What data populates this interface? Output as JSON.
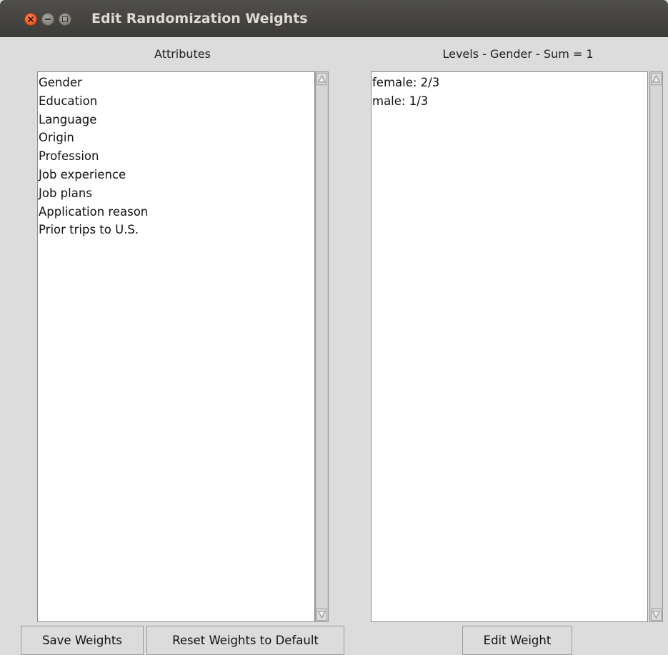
{
  "window": {
    "title": "Edit Randomization Weights",
    "controls": [
      "close-icon",
      "minimize-icon",
      "maximize-icon"
    ]
  },
  "attributes_panel": {
    "label": "Attributes",
    "items": [
      "Gender",
      "Education",
      "Language",
      "Origin",
      "Profession",
      "Job experience",
      "Job plans",
      "Application reason",
      "Prior trips to U.S."
    ]
  },
  "levels_panel": {
    "label": "Levels - Gender - Sum = 1",
    "items": [
      "female: 2/3",
      "male: 1/3"
    ]
  },
  "buttons": {
    "save": "Save Weights",
    "reset": "Reset Weights to Default",
    "edit": "Edit Weight"
  },
  "colors": {
    "titlebar": "#3c3b37",
    "close_button": "#df4a16",
    "window_background": "#dcdcdc",
    "listbox_background": "#ffffff"
  }
}
